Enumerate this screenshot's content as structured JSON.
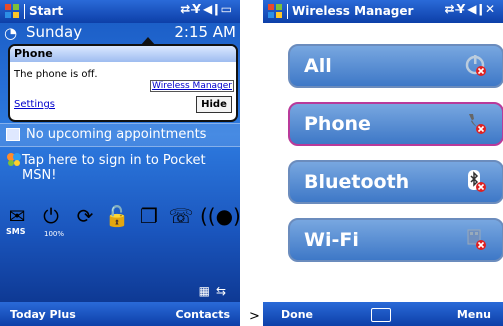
{
  "left": {
    "title": "Start",
    "day": "Sunday",
    "time": "2:15 AM",
    "popup": {
      "title": "Phone",
      "message": "The phone is off.",
      "link": "Wireless Manager",
      "settings": "Settings",
      "hide": "Hide"
    },
    "appointments": "No upcoming appointments",
    "msn": "Tap here to sign in to Pocket MSN!",
    "sms_label": "SMS",
    "battery_label": "100%",
    "softkeys": {
      "left": "Today Plus",
      "right": "Contacts"
    }
  },
  "arrow": ">",
  "right": {
    "title": "Wireless Manager",
    "buttons": [
      {
        "label": "All"
      },
      {
        "label": "Phone"
      },
      {
        "label": "Bluetooth"
      },
      {
        "label": "Wi-Fi"
      }
    ],
    "softkeys": {
      "left": "Done",
      "right": "Menu"
    }
  },
  "colors": {
    "titlebar": "#1a4fc0",
    "selected_border": "#b93a9a",
    "button_fill": "#5a8fd6",
    "off_indicator": "#e02020"
  }
}
